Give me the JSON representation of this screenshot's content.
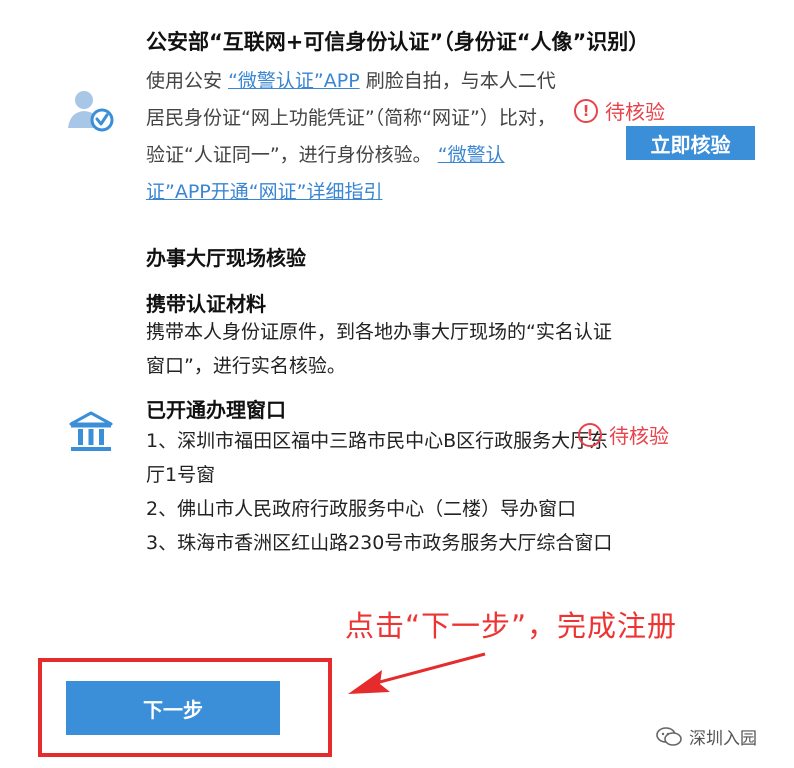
{
  "online": {
    "title": "公安部“互联网+可信身份认证”（身份证“人像”识别）",
    "desc_part1": "使用公安",
    "desc_link1": "“微警认证”APP",
    "desc_part2": "刷脸自拍，与本人二代居民身份证“网上功能凭证”（简称“网证”）比对，验证“人证同一”，进行身份核验。",
    "desc_link2": "“微警认证”APP开通“网证”详细指引",
    "status": "待核验",
    "verify_button": "立即核验"
  },
  "hall": {
    "title": "办事大厅现场核验",
    "materials_heading": "携带认证材料",
    "materials_desc": "携带本人身份证原件，到各地办事大厅现场的“实名认证窗口”，进行实名核验。",
    "windows_heading": "已开通办理窗口",
    "windows": [
      "1、深圳市福田区福中三路市民中心B区行政服务大厅东厅1号窗",
      "2、佛山市人民政府行政服务中心（二楼）导办窗口",
      "3、珠海市香洲区红山路230号市政务服务大厅综合窗口"
    ],
    "status": "待核验"
  },
  "annotation": "点击“下一步”，完成注册",
  "next_button": "下一步",
  "watermark": "深圳入园",
  "icons": {
    "user": "user-verified-icon",
    "hall": "government-building-icon",
    "warning": "exclamation-circle-icon",
    "arrow": "red-arrow-icon",
    "watermark": "wechat-icon"
  },
  "colors": {
    "accent": "#3b8ed8",
    "link": "#3a86d3",
    "warning": "#e8424b",
    "annotation": "#ee3333"
  }
}
